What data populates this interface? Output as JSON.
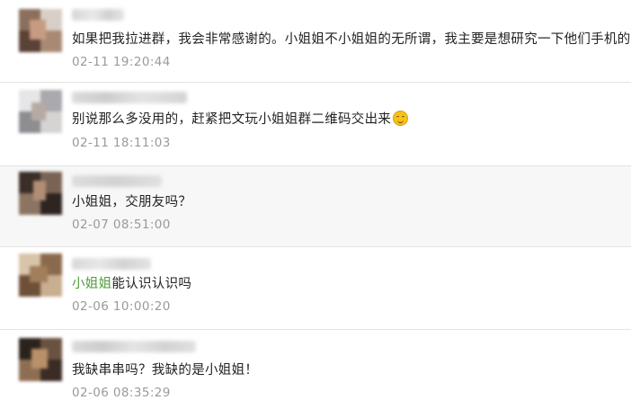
{
  "comments": [
    {
      "avatar": "blurred-avatar",
      "text": "如果把我拉进群，我会非常感谢的。小姐姐不小姐姐的无所谓，我主要是想研究一下他们手机的串串",
      "time": "02-11 19:20:44"
    },
    {
      "avatar": "blurred-avatar",
      "text": "别说那么多没用的，赶紧把文玩小姐姐群二维码交出来",
      "emoji": "grinning-face-emoji",
      "time": "02-11 18:11:03"
    },
    {
      "avatar": "blurred-avatar",
      "text": "小姐姐，交朋友吗？",
      "time": "02-07 08:51:00"
    },
    {
      "avatar": "blurred-avatar",
      "mention": "小姐姐",
      "text": "能认识认识吗",
      "time": "02-06 10:00:20"
    },
    {
      "avatar": "blurred-avatar",
      "text": "我缺串串吗？我缺的是小姐姐！",
      "time": "02-06 08:35:29"
    }
  ],
  "colors": {
    "text": "#222222",
    "time": "#9a9a9a",
    "mention": "#4f9b3a",
    "highlight_row": "#f7f7f7",
    "divider": "#e4e4e4"
  }
}
